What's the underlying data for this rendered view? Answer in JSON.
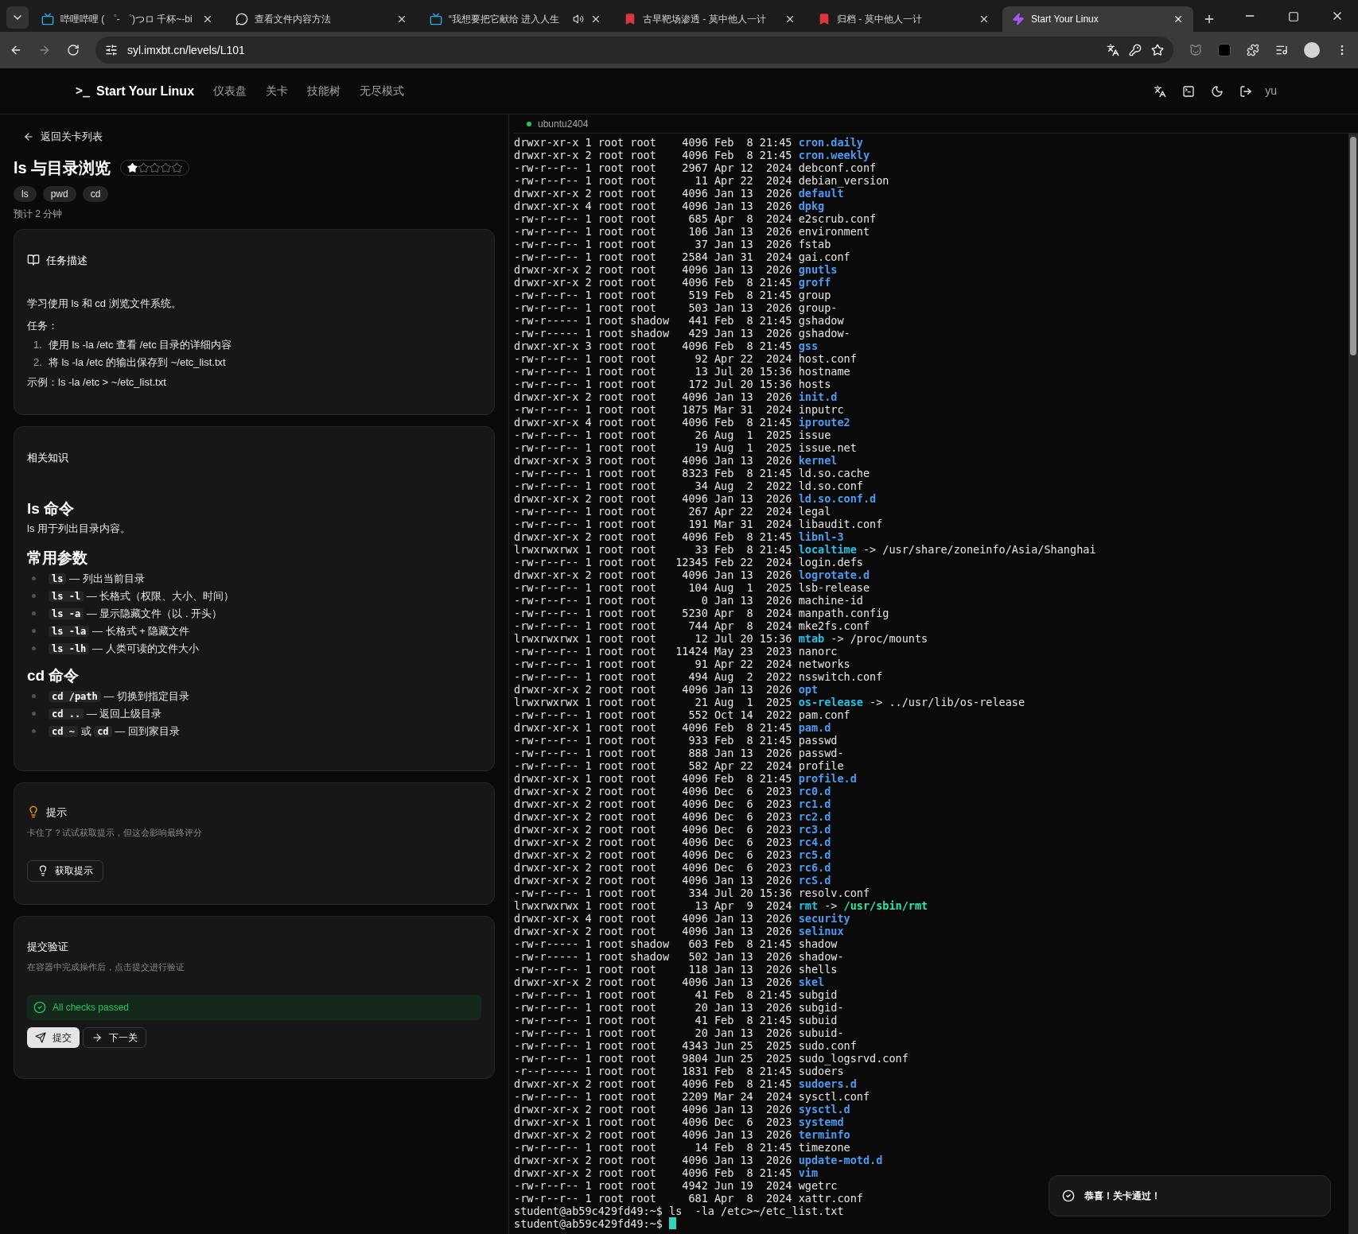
{
  "browser": {
    "tabs": [
      {
        "title": "哔哩哔哩 ( ゜- ゜)つロ 千杯~-bi",
        "kind": "tv",
        "audio": false,
        "selected": false
      },
      {
        "title": "查看文件内容方法",
        "kind": "chat",
        "audio": false,
        "selected": false
      },
      {
        "title": "“我想要把它献给 进入人生",
        "kind": "tv",
        "audio": true,
        "selected": false
      },
      {
        "title": "古早靶场渗透 - 莫中他人一计",
        "kind": "mark",
        "audio": false,
        "selected": false
      },
      {
        "title": "归档 - 莫中他人一计",
        "kind": "mark",
        "audio": false,
        "selected": false
      },
      {
        "title": "Start Your Linux",
        "kind": "bolt",
        "audio": false,
        "selected": true
      }
    ],
    "url": "syl.imxbt.cn/levels/L101"
  },
  "nav": {
    "logo": ">_",
    "brand": "Start Your Linux",
    "links": [
      "仪表盘",
      "关卡",
      "技能树",
      "无尽模式"
    ],
    "user": "yu"
  },
  "level": {
    "back": "返回关卡列表",
    "title": "ls 与目录浏览",
    "stars": 1,
    "tags": [
      "ls",
      "pwd",
      "cd"
    ],
    "estimate": "预计 2 分钟"
  },
  "task": {
    "heading": "任务描述",
    "intro": "学习使用 ls 和 cd 浏览文件系统。",
    "label": "任务：",
    "steps": [
      {
        "num": "1.",
        "text": "使用 ls -la /etc 查看 /etc 目录的详细内容"
      },
      {
        "num": "2.",
        "text": "将 ls -la /etc 的输出保存到 ~/etc_list.txt"
      }
    ],
    "example": "示例：ls -la /etc > ~/etc_list.txt"
  },
  "knowledge": {
    "heading": "相关知识",
    "sections": [
      {
        "title": "ls 命令",
        "text": "ls 用于列出目录内容。"
      },
      {
        "title": "常用参数",
        "items": [
          [
            {
              "kind": "code",
              "text": "ls"
            },
            {
              "kind": "text",
              "text": " — 列出当前目录"
            }
          ],
          [
            {
              "kind": "code",
              "text": "ls -l"
            },
            {
              "kind": "text",
              "text": " — 长格式（权限、大小、时间）"
            }
          ],
          [
            {
              "kind": "code",
              "text": "ls -a"
            },
            {
              "kind": "text",
              "text": " — 显示隐藏文件（以 . 开头）"
            }
          ],
          [
            {
              "kind": "code",
              "text": "ls -la"
            },
            {
              "kind": "text",
              "text": " — 长格式 + 隐藏文件"
            }
          ],
          [
            {
              "kind": "code",
              "text": "ls -lh"
            },
            {
              "kind": "text",
              "text": " — 人类可读的文件大小"
            }
          ]
        ]
      },
      {
        "title": "cd 命令",
        "items": [
          [
            {
              "kind": "code",
              "text": "cd /path"
            },
            {
              "kind": "text",
              "text": " — 切换到指定目录"
            }
          ],
          [
            {
              "kind": "code",
              "text": "cd .."
            },
            {
              "kind": "text",
              "text": " — 返回上级目录"
            }
          ],
          [
            {
              "kind": "code",
              "text": "cd ~"
            },
            {
              "kind": "text",
              "text": " 或 "
            },
            {
              "kind": "code",
              "text": "cd"
            },
            {
              "kind": "text",
              "text": " — 回到家目录"
            }
          ]
        ]
      }
    ]
  },
  "hint": {
    "heading": "提示",
    "text": "卡住了？试试获取提示，但这会影响最终评分",
    "button": "获取提示"
  },
  "submit": {
    "heading": "提交验证",
    "text": "在容器中完成操作后，点击提交进行验证",
    "status": "All checks passed",
    "passed": true,
    "buttons": [
      {
        "label": "提交",
        "kind": "primary"
      },
      {
        "label": "下一关",
        "kind": "next"
      }
    ]
  },
  "terminal": {
    "host": "ubuntu2404",
    "connected": true,
    "lines": [
      {
        "kind": "dir",
        "meta": "drwxr-xr-x 1 root root    4096 Feb  8 21:45 ",
        "name": "cron.daily"
      },
      {
        "kind": "dir",
        "meta": "drwxr-xr-x 2 root root    4096 Feb  8 21:45 ",
        "name": "cron.weekly"
      },
      {
        "kind": "file",
        "meta": "-rw-r--r-- 1 root root    2967 Apr 12  2024 ",
        "name": "debconf.conf"
      },
      {
        "kind": "file",
        "meta": "-rw-r--r-- 1 root root      11 Apr 22  2024 ",
        "name": "debian_version"
      },
      {
        "kind": "dir",
        "meta": "drwxr-xr-x 2 root root    4096 Jan 13  2026 ",
        "name": "default"
      },
      {
        "kind": "dir",
        "meta": "drwxr-xr-x 4 root root    4096 Jan 13  2026 ",
        "name": "dpkg"
      },
      {
        "kind": "file",
        "meta": "-rw-r--r-- 1 root root     685 Apr  8  2024 ",
        "name": "e2scrub.conf"
      },
      {
        "kind": "file",
        "meta": "-rw-r--r-- 1 root root     106 Jan 13  2026 ",
        "name": "environment"
      },
      {
        "kind": "file",
        "meta": "-rw-r--r-- 1 root root      37 Jan 13  2026 ",
        "name": "fstab"
      },
      {
        "kind": "file",
        "meta": "-rw-r--r-- 1 root root    2584 Jan 31  2024 ",
        "name": "gai.conf"
      },
      {
        "kind": "dir",
        "meta": "drwxr-xr-x 2 root root    4096 Jan 13  2026 ",
        "name": "gnutls"
      },
      {
        "kind": "dir",
        "meta": "drwxr-xr-x 2 root root    4096 Feb  8 21:45 ",
        "name": "groff"
      },
      {
        "kind": "file",
        "meta": "-rw-r--r-- 1 root root     519 Feb  8 21:45 ",
        "name": "group"
      },
      {
        "kind": "file",
        "meta": "-rw-r--r-- 1 root root     503 Jan 13  2026 ",
        "name": "group-"
      },
      {
        "kind": "file",
        "meta": "-rw-r----- 1 root shadow   441 Feb  8 21:45 ",
        "name": "gshadow"
      },
      {
        "kind": "file",
        "meta": "-rw-r----- 1 root shadow   429 Jan 13  2026 ",
        "name": "gshadow-"
      },
      {
        "kind": "dir",
        "meta": "drwxr-xr-x 3 root root    4096 Feb  8 21:45 ",
        "name": "gss"
      },
      {
        "kind": "file",
        "meta": "-rw-r--r-- 1 root root      92 Apr 22  2024 ",
        "name": "host.conf"
      },
      {
        "kind": "file",
        "meta": "-rw-r--r-- 1 root root      13 Jul 20 15:36 ",
        "name": "hostname"
      },
      {
        "kind": "file",
        "meta": "-rw-r--r-- 1 root root     172 Jul 20 15:36 ",
        "name": "hosts"
      },
      {
        "kind": "dir",
        "meta": "drwxr-xr-x 2 root root    4096 Jan 13  2026 ",
        "name": "init.d"
      },
      {
        "kind": "file",
        "meta": "-rw-r--r-- 1 root root    1875 Mar 31  2024 ",
        "name": "inputrc"
      },
      {
        "kind": "dir",
        "meta": "drwxr-xr-x 4 root root    4096 Feb  8 21:45 ",
        "name": "iproute2"
      },
      {
        "kind": "file",
        "meta": "-rw-r--r-- 1 root root      26 Aug  1  2025 ",
        "name": "issue"
      },
      {
        "kind": "file",
        "meta": "-rw-r--r-- 1 root root      19 Aug  1  2025 ",
        "name": "issue.net"
      },
      {
        "kind": "dir",
        "meta": "drwxr-xr-x 3 root root    4096 Jan 13  2026 ",
        "name": "kernel"
      },
      {
        "kind": "file",
        "meta": "-rw-r--r-- 1 root root    8323 Feb  8 21:45 ",
        "name": "ld.so.cache"
      },
      {
        "kind": "file",
        "meta": "-rw-r--r-- 1 root root      34 Aug  2  2022 ",
        "name": "ld.so.conf"
      },
      {
        "kind": "dir",
        "meta": "drwxr-xr-x 2 root root    4096 Jan 13  2026 ",
        "name": "ld.so.conf.d"
      },
      {
        "kind": "file",
        "meta": "-rw-r--r-- 1 root root     267 Apr 22  2024 ",
        "name": "legal"
      },
      {
        "kind": "file",
        "meta": "-rw-r--r-- 1 root root     191 Mar 31  2024 ",
        "name": "libaudit.conf"
      },
      {
        "kind": "dir",
        "meta": "drwxr-xr-x 2 root root    4096 Feb  8 21:45 ",
        "name": "libnl-3"
      },
      {
        "kind": "link",
        "meta": "lrwxrwxrwx 1 root root      33 Feb  8 21:45 ",
        "name": "localtime",
        "arrow": " -> ",
        "target": "/usr/share/zoneinfo/Asia/Shanghai",
        "target_executable": false
      },
      {
        "kind": "file",
        "meta": "-rw-r--r-- 1 root root   12345 Feb 22  2024 ",
        "name": "login.defs"
      },
      {
        "kind": "dir",
        "meta": "drwxr-xr-x 2 root root    4096 Jan 13  2026 ",
        "name": "logrotate.d"
      },
      {
        "kind": "file",
        "meta": "-rw-r--r-- 1 root root     104 Aug  1  2025 ",
        "name": "lsb-release"
      },
      {
        "kind": "file",
        "meta": "-rw-r--r-- 1 root root       0 Jan 13  2026 ",
        "name": "machine-id"
      },
      {
        "kind": "file",
        "meta": "-rw-r--r-- 1 root root    5230 Apr  8  2024 ",
        "name": "manpath.config"
      },
      {
        "kind": "file",
        "meta": "-rw-r--r-- 1 root root     744 Apr  8  2024 ",
        "name": "mke2fs.conf"
      },
      {
        "kind": "link",
        "meta": "lrwxrwxrwx 1 root root      12 Jul 20 15:36 ",
        "name": "mtab",
        "arrow": " -> ",
        "target": "/proc/mounts",
        "target_executable": false
      },
      {
        "kind": "file",
        "meta": "-rw-r--r-- 1 root root   11424 May 23  2023 ",
        "name": "nanorc"
      },
      {
        "kind": "file",
        "meta": "-rw-r--r-- 1 root root      91 Apr 22  2024 ",
        "name": "networks"
      },
      {
        "kind": "file",
        "meta": "-rw-r--r-- 1 root root     494 Aug  2  2022 ",
        "name": "nsswitch.conf"
      },
      {
        "kind": "dir",
        "meta": "drwxr-xr-x 2 root root    4096 Jan 13  2026 ",
        "name": "opt"
      },
      {
        "kind": "link",
        "meta": "lrwxrwxrwx 1 root root      21 Aug  1  2025 ",
        "name": "os-release",
        "arrow": " -> ",
        "target": "../usr/lib/os-release",
        "target_executable": false
      },
      {
        "kind": "file",
        "meta": "-rw-r--r-- 1 root root     552 Oct 14  2022 ",
        "name": "pam.conf"
      },
      {
        "kind": "dir",
        "meta": "drwxr-xr-x 1 root root    4096 Feb  8 21:45 ",
        "name": "pam.d"
      },
      {
        "kind": "file",
        "meta": "-rw-r--r-- 1 root root     933 Feb  8 21:45 ",
        "name": "passwd"
      },
      {
        "kind": "file",
        "meta": "-rw-r--r-- 1 root root     888 Jan 13  2026 ",
        "name": "passwd-"
      },
      {
        "kind": "file",
        "meta": "-rw-r--r-- 1 root root     582 Apr 22  2024 ",
        "name": "profile"
      },
      {
        "kind": "dir",
        "meta": "drwxr-xr-x 1 root root    4096 Feb  8 21:45 ",
        "name": "profile.d"
      },
      {
        "kind": "dir",
        "meta": "drwxr-xr-x 2 root root    4096 Dec  6  2023 ",
        "name": "rc0.d"
      },
      {
        "kind": "dir",
        "meta": "drwxr-xr-x 2 root root    4096 Dec  6  2023 ",
        "name": "rc1.d"
      },
      {
        "kind": "dir",
        "meta": "drwxr-xr-x 2 root root    4096 Dec  6  2023 ",
        "name": "rc2.d"
      },
      {
        "kind": "dir",
        "meta": "drwxr-xr-x 2 root root    4096 Dec  6  2023 ",
        "name": "rc3.d"
      },
      {
        "kind": "dir",
        "meta": "drwxr-xr-x 2 root root    4096 Dec  6  2023 ",
        "name": "rc4.d"
      },
      {
        "kind": "dir",
        "meta": "drwxr-xr-x 2 root root    4096 Dec  6  2023 ",
        "name": "rc5.d"
      },
      {
        "kind": "dir",
        "meta": "drwxr-xr-x 2 root root    4096 Dec  6  2023 ",
        "name": "rc6.d"
      },
      {
        "kind": "dir",
        "meta": "drwxr-xr-x 2 root root    4096 Jan 13  2026 ",
        "name": "rcS.d"
      },
      {
        "kind": "file",
        "meta": "-rw-r--r-- 1 root root     334 Jul 20 15:36 ",
        "name": "resolv.conf"
      },
      {
        "kind": "link",
        "meta": "lrwxrwxrwx 1 root root      13 Apr  9  2024 ",
        "name": "rmt",
        "arrow": " -> ",
        "target": "/usr/sbin/rmt",
        "target_executable": true
      },
      {
        "kind": "dir",
        "meta": "drwxr-xr-x 4 root root    4096 Jan 13  2026 ",
        "name": "security"
      },
      {
        "kind": "dir",
        "meta": "drwxr-xr-x 2 root root    4096 Jan 13  2026 ",
        "name": "selinux"
      },
      {
        "kind": "file",
        "meta": "-rw-r----- 1 root shadow   603 Feb  8 21:45 ",
        "name": "shadow"
      },
      {
        "kind": "file",
        "meta": "-rw-r----- 1 root shadow   502 Jan 13  2026 ",
        "name": "shadow-"
      },
      {
        "kind": "file",
        "meta": "-rw-r--r-- 1 root root     118 Jan 13  2026 ",
        "name": "shells"
      },
      {
        "kind": "dir",
        "meta": "drwxr-xr-x 2 root root    4096 Jan 13  2026 ",
        "name": "skel"
      },
      {
        "kind": "file",
        "meta": "-rw-r--r-- 1 root root      41 Feb  8 21:45 ",
        "name": "subgid"
      },
      {
        "kind": "file",
        "meta": "-rw-r--r-- 1 root root      20 Jan 13  2026 ",
        "name": "subgid-"
      },
      {
        "kind": "file",
        "meta": "-rw-r--r-- 1 root root      41 Feb  8 21:45 ",
        "name": "subuid"
      },
      {
        "kind": "file",
        "meta": "-rw-r--r-- 1 root root      20 Jan 13  2026 ",
        "name": "subuid-"
      },
      {
        "kind": "file",
        "meta": "-rw-r--r-- 1 root root    4343 Jun 25  2025 ",
        "name": "sudo.conf"
      },
      {
        "kind": "file",
        "meta": "-rw-r--r-- 1 root root    9804 Jun 25  2025 ",
        "name": "sudo_logsrvd.conf"
      },
      {
        "kind": "file",
        "meta": "-r--r----- 1 root root    1831 Feb  8 21:45 ",
        "name": "sudoers"
      },
      {
        "kind": "dir",
        "meta": "drwxr-xr-x 2 root root    4096 Feb  8 21:45 ",
        "name": "sudoers.d"
      },
      {
        "kind": "file",
        "meta": "-rw-r--r-- 1 root root    2209 Mar 24  2024 ",
        "name": "sysctl.conf"
      },
      {
        "kind": "dir",
        "meta": "drwxr-xr-x 2 root root    4096 Jan 13  2026 ",
        "name": "sysctl.d"
      },
      {
        "kind": "dir",
        "meta": "drwxr-xr-x 1 root root    4096 Dec  6  2023 ",
        "name": "systemd"
      },
      {
        "kind": "dir",
        "meta": "drwxr-xr-x 2 root root    4096 Jan 13  2026 ",
        "name": "terminfo"
      },
      {
        "kind": "file",
        "meta": "-rw-r--r-- 1 root root      14 Feb  8 21:45 ",
        "name": "timezone"
      },
      {
        "kind": "dir",
        "meta": "drwxr-xr-x 2 root root    4096 Jan 13  2026 ",
        "name": "update-motd.d"
      },
      {
        "kind": "dir",
        "meta": "drwxr-xr-x 2 root root    4096 Feb  8 21:45 ",
        "name": "vim"
      },
      {
        "kind": "file",
        "meta": "-rw-r--r-- 1 root root    4942 Jun 19  2024 ",
        "name": "wgetrc"
      },
      {
        "kind": "file",
        "meta": "-rw-r--r-- 1 root root     681 Apr  8  2024 ",
        "name": "xattr.conf"
      },
      {
        "kind": "prompt",
        "prompt": "student@ab59c429fd49:~$ ",
        "command": "ls  -la /etc>~/etc_list.txt",
        "cursor": false
      },
      {
        "kind": "prompt",
        "prompt": "student@ab59c429fd49:~$ ",
        "cursor": true
      }
    ]
  },
  "toast": {
    "text": "恭喜！关卡通过！"
  }
}
